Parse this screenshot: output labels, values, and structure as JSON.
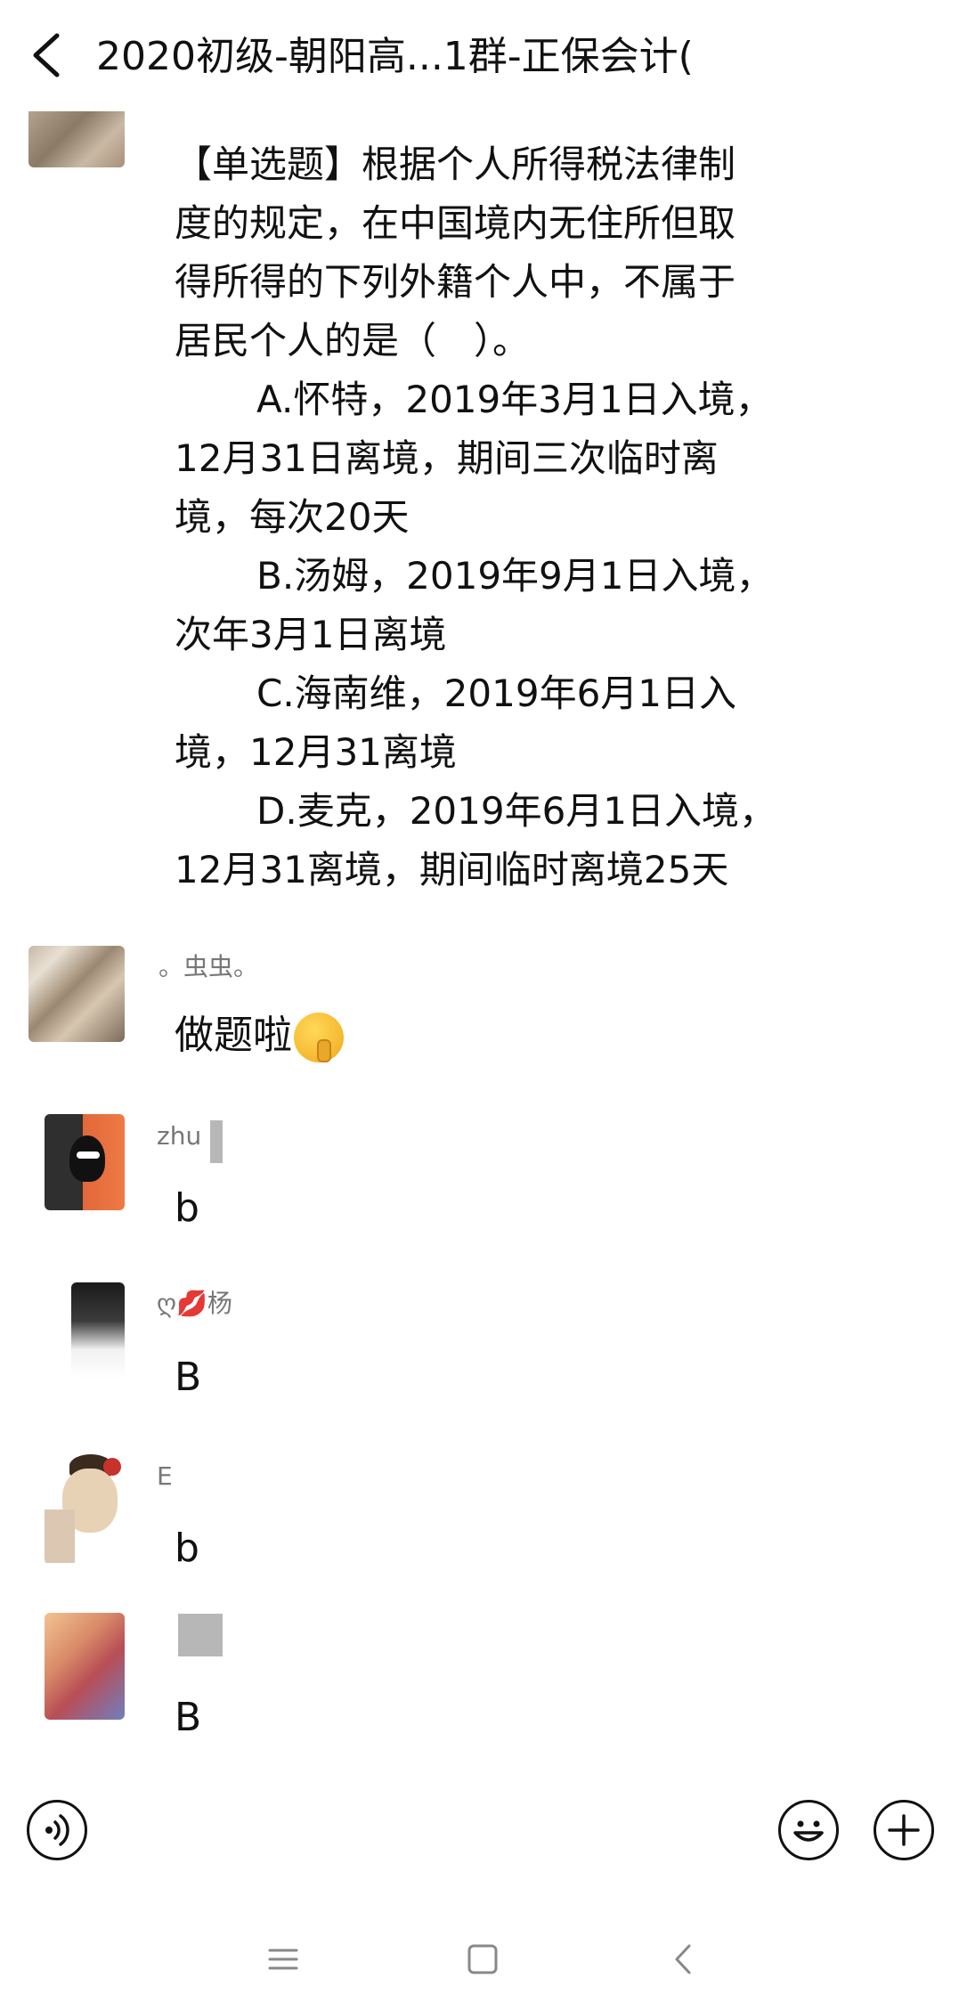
{
  "header": {
    "title": "2020初级-朝阳高...1群-正保会计("
  },
  "question": {
    "lines": [
      "【单选题】根据个人所得税法律制",
      "度的规定，在中国境内无住所但取",
      "得所得的下列外籍个人中，不属于",
      "居民个人的是（　）。",
      "A.怀特，2019年3月1日入境，",
      "12月31日离境，期间三次临时离",
      "境，每次20天",
      "B.汤姆，2019年9月1日入境，",
      "次年3月1日离境",
      "C.海南维，2019年6月1日入",
      "境，12月31离境",
      "D.麦克，2019年6月1日入境，",
      "12月31离境，期间临时离境25天"
    ]
  },
  "messages": [
    {
      "sender": "。虫虫。",
      "text": "做题啦",
      "emoji": "shushing-face-emoji"
    },
    {
      "sender": "zhu",
      "text": "b"
    },
    {
      "sender": "ღ",
      "sender_suffix": "杨",
      "emoji": "kiss-mark-icon",
      "text": "B"
    },
    {
      "sender": "E",
      "text": "b"
    },
    {
      "sender": "",
      "text": "B"
    }
  ],
  "input_bar": {
    "left_icon": "voice-icon",
    "right_icons": [
      "emoji-icon",
      "plus-icon"
    ]
  },
  "nav_bar": {
    "icons": [
      "menu-icon",
      "home-icon",
      "back-icon"
    ]
  }
}
